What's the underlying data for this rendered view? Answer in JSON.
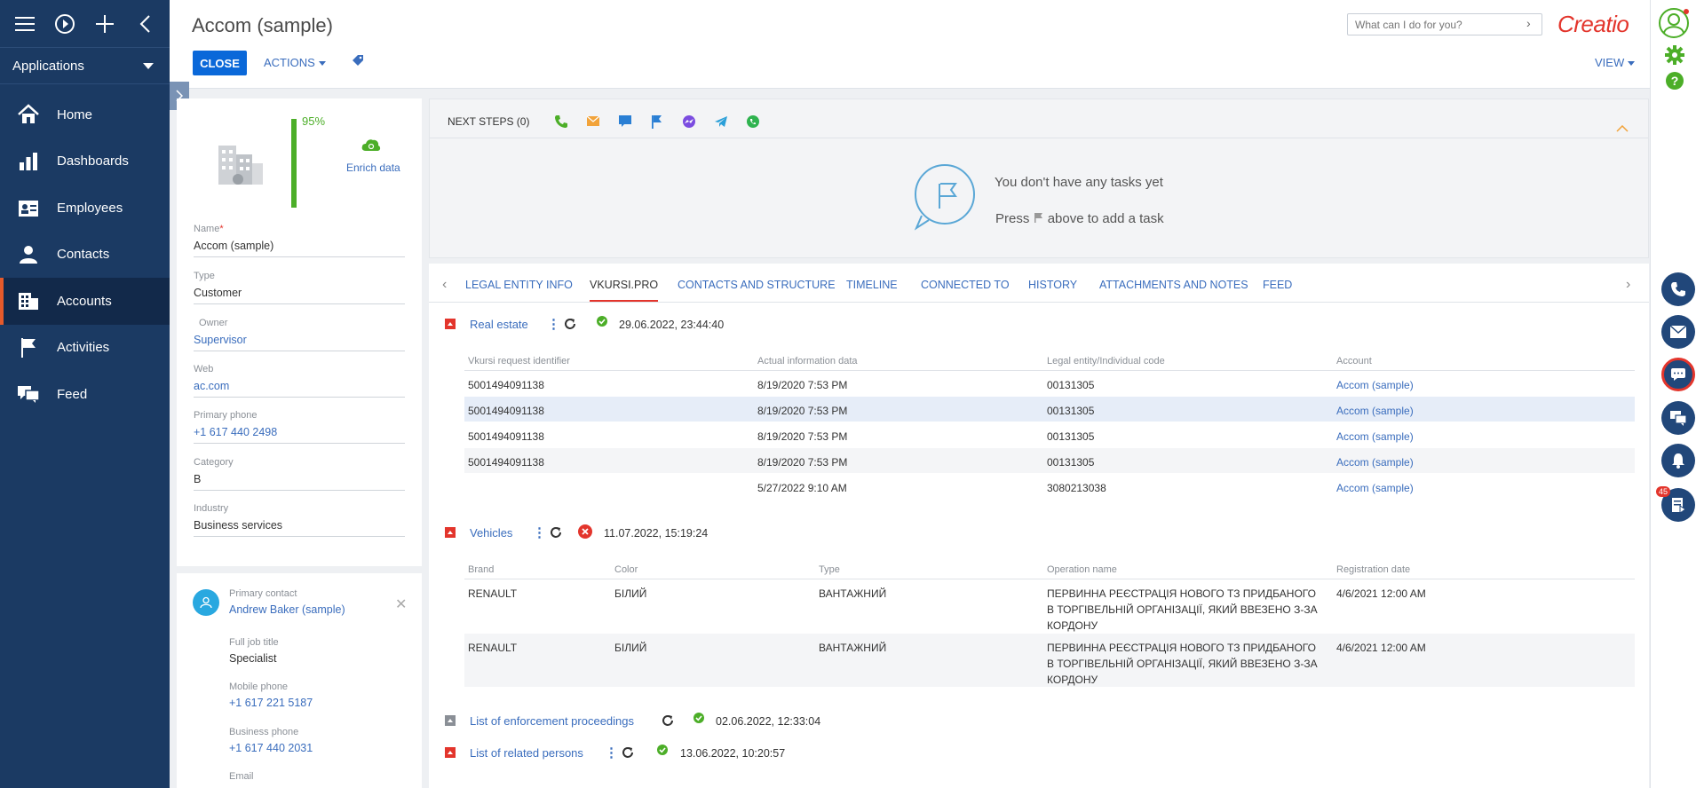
{
  "app": {
    "applications_label": "Applications",
    "nav": [
      {
        "label": "Home",
        "icon": "home-icon"
      },
      {
        "label": "Dashboards",
        "icon": "dashboards-icon"
      },
      {
        "label": "Employees",
        "icon": "employees-icon"
      },
      {
        "label": "Contacts",
        "icon": "contacts-icon"
      },
      {
        "label": "Accounts",
        "icon": "accounts-icon",
        "active": true
      },
      {
        "label": "Activities",
        "icon": "activities-icon"
      },
      {
        "label": "Feed",
        "icon": "feed-icon"
      }
    ]
  },
  "header": {
    "title": "Accom (sample)",
    "close_label": "CLOSE",
    "actions_label": "ACTIONS",
    "view_label": "VIEW",
    "search_placeholder": "What can I do for you?",
    "logo": "Creatio"
  },
  "profile": {
    "completeness": "95%",
    "enrich_label": "Enrich data",
    "fields": {
      "name_label": "Name",
      "name_value": "Accom (sample)",
      "type_label": "Type",
      "type_value": "Customer",
      "owner_label": "Owner",
      "owner_value": "Supervisor",
      "web_label": "Web",
      "web_value": "ac.com",
      "phone_label": "Primary phone",
      "phone_value": "+1 617 440 2498",
      "category_label": "Category",
      "category_value": "B",
      "industry_label": "Industry",
      "industry_value": "Business services"
    }
  },
  "contact": {
    "primary_label": "Primary contact",
    "primary_value": "Andrew Baker (sample)",
    "job_label": "Full job title",
    "job_value": "Specialist",
    "mobile_label": "Mobile phone",
    "mobile_value": "+1 617 221 5187",
    "business_label": "Business phone",
    "business_value": "+1 617 440 2031",
    "email_label": "Email"
  },
  "next_steps": {
    "label": "NEXT STEPS (0)",
    "empty_line1": "You don't have any tasks yet",
    "empty_line2_a": "Press",
    "empty_line2_b": "above to add a task"
  },
  "tabs": [
    "LEGAL ENTITY INFO",
    "VKURSI.PRO",
    "CONTACTS AND STRUCTURE",
    "TIMELINE",
    "CONNECTED TO",
    "HISTORY",
    "ATTACHMENTS AND NOTES",
    "FEED"
  ],
  "real_estate": {
    "title": "Real estate",
    "stamp": "29.06.2022, 23:44:40",
    "columns": [
      "Vkursi request identifier",
      "Actual information data",
      "Legal entity/Individual code",
      "Account"
    ],
    "rows": [
      [
        "5001494091138",
        "8/19/2020 7:53 PM",
        "00131305",
        "Accom (sample)"
      ],
      [
        "5001494091138",
        "8/19/2020 7:53 PM",
        "00131305",
        "Accom (sample)"
      ],
      [
        "5001494091138",
        "8/19/2020 7:53 PM",
        "00131305",
        "Accom (sample)"
      ],
      [
        "5001494091138",
        "8/19/2020 7:53 PM",
        "00131305",
        "Accom (sample)"
      ],
      [
        "",
        "5/27/2022 9:10 AM",
        "3080213038",
        "Accom (sample)"
      ]
    ]
  },
  "vehicles": {
    "title": "Vehicles",
    "stamp": "11.07.2022, 15:19:24",
    "columns": [
      "Brand",
      "Color",
      "Type",
      "Operation name",
      "Registration date"
    ],
    "rows": [
      [
        "RENAULT",
        "БІЛИЙ",
        "ВАНТАЖНИЙ",
        "ПЕРВИННА РЕЄСТРАЦІЯ НОВОГО ТЗ ПРИДБАНОГО В ТОРГІВЕЛЬНІЙ ОРГАНІЗАЦІЇ, ЯКИЙ ВВЕЗЕНО З-ЗА КОРДОНУ",
        "4/6/2021 12:00 AM"
      ],
      [
        "RENAULT",
        "БІЛИЙ",
        "ВАНТАЖНИЙ",
        "ПЕРВИННА РЕЄСТРАЦІЯ НОВОГО ТЗ ПРИДБАНОГО В ТОРГІВЕЛЬНІЙ ОРГАНІЗАЦІЇ, ЯКИЙ ВВЕЗЕНО З-ЗА КОРДОНУ",
        "4/6/2021 12:00 AM"
      ]
    ]
  },
  "enforcement": {
    "title": "List of enforcement proceedings",
    "stamp": "02.06.2022, 12:33:04"
  },
  "related": {
    "title": "List of related persons",
    "stamp": "13.06.2022, 10:20:57"
  },
  "rail": {
    "badge": "45"
  },
  "colors": {
    "nav_bg": "#1b3a63",
    "accent": "#e3352c",
    "primary_btn": "#0a68d9",
    "link": "#3a6dbd",
    "success": "#4cae28"
  }
}
